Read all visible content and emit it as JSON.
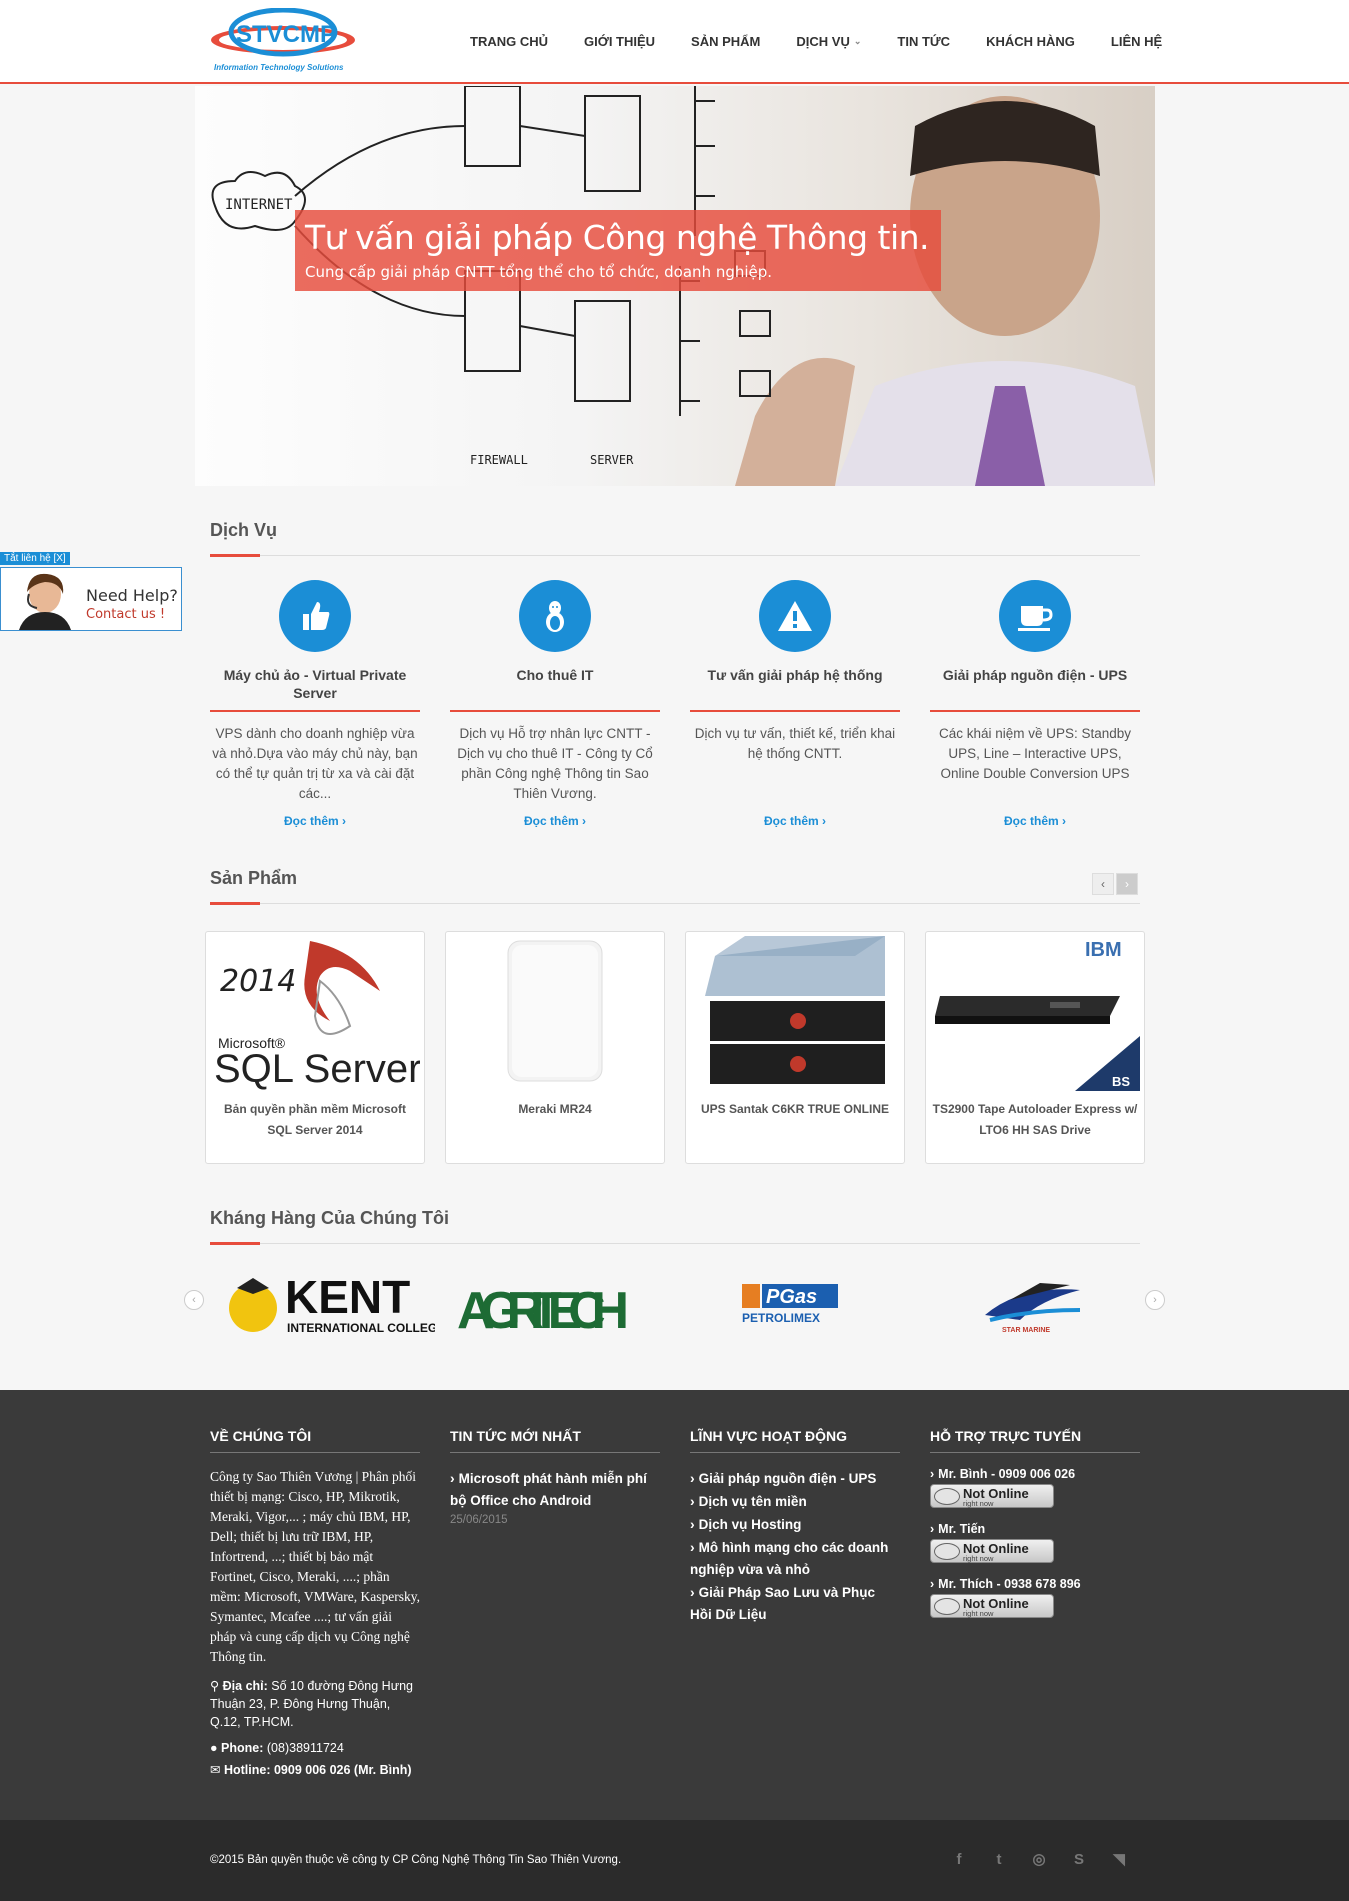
{
  "header": {
    "logo_tagline": "Information Technology Solutions",
    "nav": [
      {
        "label": "TRANG CHỦ"
      },
      {
        "label": "GIỚI THIỆU"
      },
      {
        "label": "SẢN PHẨM"
      },
      {
        "label": "DỊCH VỤ"
      },
      {
        "label": "TIN TỨC"
      },
      {
        "label": "KHÁCH HÀNG"
      },
      {
        "label": "LIÊN HỆ"
      }
    ]
  },
  "hero": {
    "title": "Tư vấn giải pháp Công nghệ Thông tin.",
    "subtitle": "Cung cấp giải pháp CNTT tổng thể cho tổ chức, doanh nghiệp.",
    "sketch_labels": {
      "internet": "INTERNET",
      "firewall": "FIREWALL",
      "server": "SERVER"
    }
  },
  "side_contact": {
    "close_label": "Tắt liên hệ [X]",
    "need_help": "Need Help?",
    "contact_us": "Contact us !"
  },
  "services": {
    "title": "Dịch Vụ",
    "items": [
      {
        "icon": "thumbs-up-icon",
        "name": "Máy chủ ảo - Virtual Private Server",
        "desc": "VPS dành cho doanh nghiệp vừa và nhỏ.Dựa vào máy chủ này, bạn có thể tự quản trị từ xa và cài đặt các...",
        "more": "Đọc thêm"
      },
      {
        "icon": "linux-icon",
        "name": "Cho thuê IT",
        "desc": "Dịch vụ Hỗ trợ nhân lực CNTT - Dịch vụ cho thuê IT - Công ty Cổ phần Công nghệ Thông tin Sao Thiên Vương.",
        "more": "Đọc thêm"
      },
      {
        "icon": "warning-icon",
        "name": "Tư vấn giải pháp hệ thống",
        "desc": "Dịch vụ tư vấn, thiết kế, triển khai hệ thống CNTT.",
        "more": "Đọc thêm"
      },
      {
        "icon": "coffee-icon",
        "name": "Giải pháp nguồn điện - UPS",
        "desc": "Các khái niệm về UPS: Standby UPS, Line – Interactive UPS, Online Double Conversion UPS",
        "more": "Đọc thêm"
      }
    ]
  },
  "products": {
    "title": "Sản Phẩm",
    "items": [
      {
        "name": "Bản quyền phần mềm Microsoft SQL Server 2014",
        "img_text": {
          "year": "2014",
          "brand": "Microsoft®",
          "product": "SQL Server"
        }
      },
      {
        "name": "Meraki MR24"
      },
      {
        "name": "UPS Santak C6KR TRUE ONLINE"
      },
      {
        "name": "TS2900 Tape Autoloader Express w/ LTO6 HH SAS Drive",
        "img_text": {
          "brand": "IBM",
          "badge": "BS"
        }
      }
    ]
  },
  "customers": {
    "title": "Kháng Hàng Của Chúng Tôi",
    "logos": [
      {
        "name": "KENT",
        "sub": "INTERNATIONAL COLLEGE"
      },
      {
        "name": "AGRITECH"
      },
      {
        "name": "PGas",
        "sub": "PETROLIMEX"
      },
      {
        "name": "STAR MARINE"
      }
    ]
  },
  "footer": {
    "about": {
      "title": "VỀ CHÚNG TÔI",
      "text": "Công ty Sao Thiên Vương | Phân phối thiết bị mạng: Cisco, HP, Mikrotik, Meraki, Vigor,... ; máy chủ IBM, HP, Dell; thiết bị lưu trữ IBM, HP, Infortrend, ...; thiết bị bảo mật Fortinet, Cisco, Meraki, ....; phần mềm: Microsoft, VMWare, Kaspersky, Symantec, Mcafee ....; tư vấn giải pháp và cung cấp dịch vụ Công nghệ Thông tin.",
      "address_label": "Địa chỉ:",
      "address": "Số 10 đường Đông Hưng Thuận 23, P. Đông Hưng Thuận, Q.12, TP.HCM.",
      "phone_label": "Phone:",
      "phone": "(08)38911724",
      "hotline_label": "Hotline:",
      "hotline": "0909 006 026 (Mr. Bình)"
    },
    "news": {
      "title": "TIN TỨC MỚI NHẤT",
      "items": [
        {
          "title": "Microsoft phát hành miễn phí bộ Office cho Android",
          "date": "25/06/2015"
        }
      ]
    },
    "fields": {
      "title": "LĨNH VỰC HOẠT ĐỘNG",
      "items": [
        "Giải pháp nguồn điện - UPS",
        "Dịch vụ tên miền",
        "Dịch vụ Hosting",
        "Mô hình mạng cho các doanh nghiệp vừa và nhỏ",
        "Giải Pháp Sao Lưu và Phục Hồi Dữ Liệu"
      ]
    },
    "support": {
      "title": "HỖ TRỢ TRỰC TUYẾN",
      "status_main": "Not Online",
      "status_sub": "right now",
      "people": [
        "Mr. Bình - 0909 006 026",
        "Mr. Tiến",
        "Mr. Thích - 0938 678 896"
      ]
    }
  },
  "copyright": {
    "text": "©2015 Bản quyền thuộc về công ty CP Công Nghệ Thông Tin Sao Thiên Vương.",
    "social": [
      "facebook-icon",
      "twitter-icon",
      "dribbble-icon",
      "skype-icon",
      "rss-icon"
    ]
  },
  "colors": {
    "accent": "#e74c3c",
    "primary": "#1b8ed6",
    "footer": "#3a3a3a",
    "footer_bottom": "#2b2b2b"
  }
}
